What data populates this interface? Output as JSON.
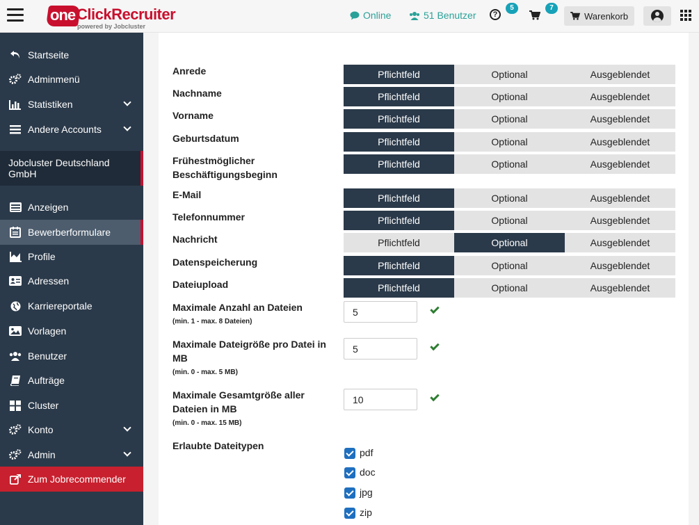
{
  "topbar": {
    "logo_one": "one",
    "logo_name": "ClickRecruiter",
    "logo_sub": "powered by Jobcluster",
    "online_label": "Online",
    "users_label": "51 Benutzer",
    "help_badge": "5",
    "cart_badge": "7",
    "warenkorb_label": "Warenkorb"
  },
  "sidebar": {
    "items_top": [
      {
        "label": "Startseite",
        "icon": "undo-icon"
      },
      {
        "label": "Adminmenü",
        "icon": "gears-icon"
      },
      {
        "label": "Statistiken",
        "icon": "bar-chart-icon"
      },
      {
        "label": "Andere Accounts",
        "icon": "bars-icon"
      }
    ],
    "company": "Jobcluster Deutschland GmbH",
    "items": [
      {
        "label": "Anzeigen",
        "icon": "list-icon"
      },
      {
        "label": "Bewerberformulare",
        "icon": "form-icon"
      },
      {
        "label": "Profile",
        "icon": "area-chart-icon"
      },
      {
        "label": "Adressen",
        "icon": "address-card-icon"
      },
      {
        "label": "Karriereportale",
        "icon": "globe-icon"
      },
      {
        "label": "Vorlagen",
        "icon": "image-icon"
      },
      {
        "label": "Benutzer",
        "icon": "users-icon"
      },
      {
        "label": "Aufträge",
        "icon": "book-icon"
      },
      {
        "label": "Cluster",
        "icon": "grid-icon"
      },
      {
        "label": "Konto",
        "icon": "gears-icon"
      },
      {
        "label": "Admin",
        "icon": "gears-icon"
      },
      {
        "label": "Zum Jobrecommender",
        "icon": "external-link-icon"
      }
    ]
  },
  "form": {
    "options": [
      "Pflichtfeld",
      "Optional",
      "Ausgeblendet"
    ],
    "fields": [
      {
        "label": "Anrede",
        "selected": "Pflichtfeld"
      },
      {
        "label": "Nachname",
        "selected": "Pflichtfeld"
      },
      {
        "label": "Vorname",
        "selected": "Pflichtfeld"
      },
      {
        "label": "Geburtsdatum",
        "selected": "Pflichtfeld"
      },
      {
        "label": "Frühestmöglicher Beschäftigungsbeginn",
        "selected": "Pflichtfeld"
      },
      {
        "label": "E-Mail",
        "selected": "Pflichtfeld"
      },
      {
        "label": "Telefonnummer",
        "selected": "Pflichtfeld"
      },
      {
        "label": "Nachricht",
        "selected": "Optional"
      },
      {
        "label": "Datenspeicherung",
        "selected": "Pflichtfeld"
      },
      {
        "label": "Dateiupload",
        "selected": "Pflichtfeld"
      }
    ],
    "limits": [
      {
        "label": "Maximale Anzahl an Dateien",
        "hint": "(min. 1 - max. 8 Dateien)",
        "value": "5"
      },
      {
        "label": "Maximale Dateigröße pro Datei in MB",
        "hint": "(min. 0 - max. 5 MB)",
        "value": "5"
      },
      {
        "label": "Maximale Gesamtgröße aller Dateien in MB",
        "hint": "(min. 0 - max. 15 MB)",
        "value": "10"
      }
    ],
    "filetypes_label": "Erlaubte Dateitypen",
    "filetypes": [
      "pdf",
      "doc",
      "jpg",
      "zip"
    ]
  },
  "colors": {
    "sidebar_bg": "#2b3a4a",
    "accent_red": "#c8102e",
    "selected_segment": "#2b3a4a",
    "teal": "#2aa198",
    "check_green": "#2e7d32"
  }
}
